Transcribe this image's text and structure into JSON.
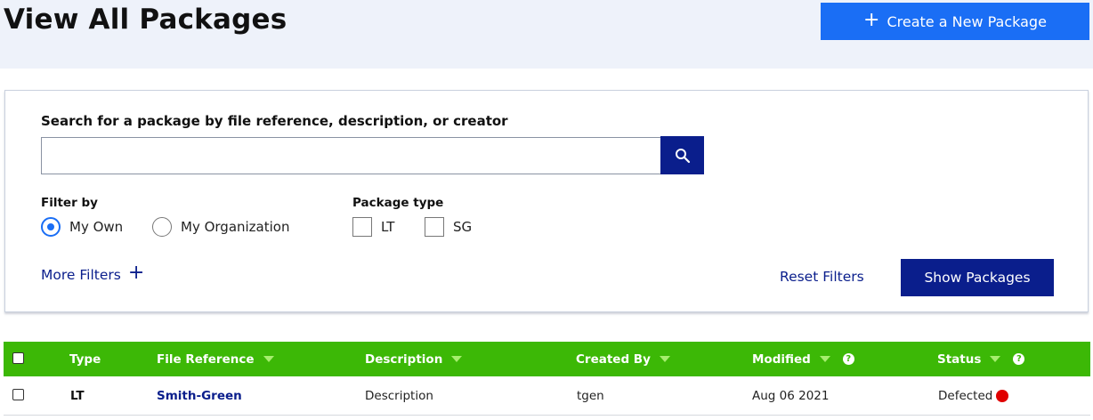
{
  "header": {
    "title": "View All Packages",
    "create_label": "Create a New Package"
  },
  "search": {
    "label": "Search for a package by file reference, description, or creator",
    "value": "",
    "placeholder": ""
  },
  "filters": {
    "filter_by_label": "Filter by",
    "options": [
      {
        "label": "My Own",
        "selected": true
      },
      {
        "label": "My Organization",
        "selected": false
      }
    ],
    "package_type_label": "Package type",
    "types": [
      {
        "label": "LT",
        "checked": false
      },
      {
        "label": "SG",
        "checked": false
      }
    ],
    "more_filters_label": "More Filters",
    "reset_label": "Reset Filters",
    "show_label": "Show Packages"
  },
  "table": {
    "columns": [
      "Type",
      "File Reference",
      "Description",
      "Created By",
      "Modified",
      "Status"
    ],
    "rows": [
      {
        "type": "LT",
        "file_reference": "Smith-Green",
        "description": "Description",
        "created_by": "tgen",
        "modified": "Aug 06 2021",
        "status": "Defected"
      }
    ]
  },
  "colors": {
    "accent_blue": "#1a6ef5",
    "navy": "#0a1e8c",
    "header_green": "#3cb806",
    "status_defected": "#e00000"
  },
  "icons": {
    "search": "magnifier",
    "plus": "+",
    "help": "?"
  }
}
